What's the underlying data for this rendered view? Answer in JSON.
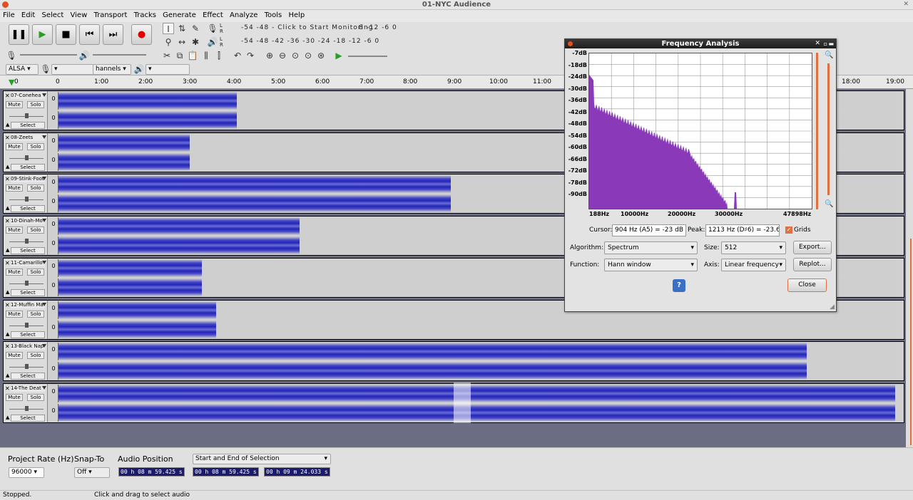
{
  "window": {
    "title": "01-NYC Audience"
  },
  "menu": [
    "File",
    "Edit",
    "Select",
    "View",
    "Transport",
    "Tracks",
    "Generate",
    "Effect",
    "Analyze",
    "Tools",
    "Help"
  ],
  "meter": {
    "record_scale": "-54  -48  -42  -36  -30  -24  -18  -12  -6  0",
    "monitor_text": "Click to Start Monitoring",
    "play_scale": "-54  -48  -42  -36  -30  -24  -18  -12  -6  0",
    "left_scale": "-54  -48"
  },
  "device": {
    "host": "ALSA",
    "channels": "hannels"
  },
  "ruler": {
    "labels": [
      "0",
      "1:00",
      "2:00",
      "3:00",
      "4:00",
      "5:00",
      "6:00",
      "7:00",
      "8:00",
      "9:00",
      "10:00",
      "11:00",
      "18:00",
      "19:00"
    ],
    "left_label": "0"
  },
  "tracks": [
    {
      "name": "07-Conehea",
      "mute": "Mute",
      "solo": "Solo",
      "select": "Select",
      "length": 0.213
    },
    {
      "name": "08-Zeets",
      "mute": "Mute",
      "solo": "Solo",
      "select": "Select",
      "length": 0.157
    },
    {
      "name": "09-Stink-Foot",
      "mute": "Mute",
      "solo": "Solo",
      "select": "Select",
      "length": 0.468
    },
    {
      "name": "10-Dinah-Mo",
      "mute": "Mute",
      "solo": "Solo",
      "select": "Select",
      "length": 0.288
    },
    {
      "name": "11-Camarillo",
      "mute": "Mute",
      "solo": "Solo",
      "select": "Select",
      "length": 0.171
    },
    {
      "name": "12-Muffin Ma",
      "mute": "Mute",
      "solo": "Solo",
      "select": "Select",
      "length": 0.188
    },
    {
      "name": "13-Black Nap",
      "mute": "Mute",
      "solo": "Solo",
      "select": "Select",
      "length": 0.893
    },
    {
      "name": "14-The Deat",
      "mute": "Mute",
      "solo": "Solo",
      "select": "Select",
      "length": 0.998
    }
  ],
  "track_scale": "0",
  "bottom": {
    "project_rate_label": "Project Rate (Hz)",
    "project_rate": "96000",
    "snap_label": "Snap-To",
    "snap": "Off",
    "audio_position_label": "Audio Position",
    "audio_position": "00 h 08 m 59.425 s",
    "selection_mode": "Start and End of Selection",
    "sel_start": "00 h 08 m 59.425 s",
    "sel_end": "00 h 09 m 24.033 s"
  },
  "status": {
    "left": "Stopped.",
    "right": "Click and drag to select audio"
  },
  "dialog": {
    "title": "Frequency Analysis",
    "y_labels": [
      "-7dB",
      "-18dB",
      "-24dB",
      "-30dB",
      "-36dB",
      "-42dB",
      "-48dB",
      "-54dB",
      "-60dB",
      "-66dB",
      "-72dB",
      "-78dB",
      "-90dB"
    ],
    "x_labels": [
      "188Hz",
      "10000Hz",
      "20000Hz",
      "30000Hz",
      "47898Hz"
    ],
    "cursor_label": "Cursor:",
    "cursor_value": "904 Hz (A5) = -23 dB",
    "peak_label": "Peak:",
    "peak_value": "1213 Hz (D♯6) = -23.6",
    "grids_label": "Grids",
    "algorithm_label": "Algorithm:",
    "algorithm": "Spectrum",
    "size_label": "Size:",
    "size": "512",
    "export_button": "Export...",
    "function_label": "Function:",
    "function": "Hann window",
    "axis_label": "Axis:",
    "axis": "Linear frequency",
    "replot_button": "Replot...",
    "close_button": "Close",
    "help_icon": "?"
  },
  "colors": {
    "waveform": "#3336c2",
    "spectrum": "#8a3ab8",
    "accent": "#e07040"
  }
}
